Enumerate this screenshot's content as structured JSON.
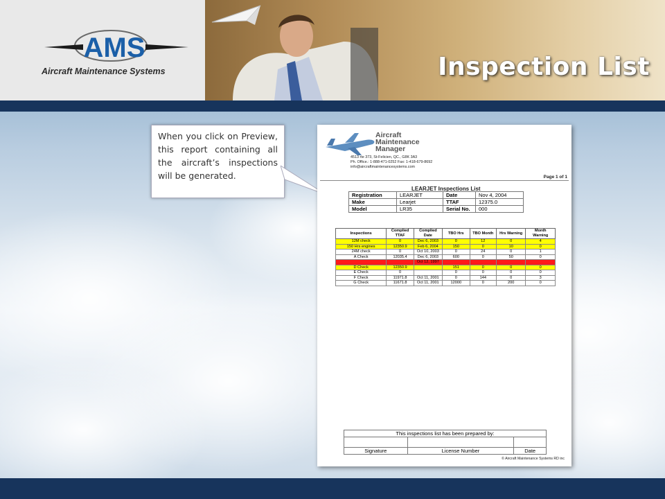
{
  "slide": {
    "title": "Inspection List",
    "logo_text": "AMS",
    "logo_subtitle": "Aircraft Maintenance Systems",
    "callout": "When you click on Preview, this report containing all the aircraft’s inspections will be generated.",
    "colors": {
      "bar": "#17345c",
      "title": "#ffffff",
      "logo_blue": "#1b5fa8",
      "row_yellow": "#ffff00",
      "row_red": "#ff1a1a"
    }
  },
  "report": {
    "brand_line1": "Aircraft",
    "brand_line2": "Maintenance",
    "brand_line3": "Manager",
    "address": "4513 rte 373, St-Felicien, QC., G8K 3A3",
    "phone": "Ph. Office.: 1-888-471-0252  Fax: 1-418-679-8692",
    "email": "info@aircraftmaintenancesystems.com",
    "page": "Page 1 of 1",
    "title": "LEARJET Inspections List",
    "info": {
      "registration_label": "Registration",
      "registration": "LEARJET",
      "date_label": "Date",
      "date": "Nov 4, 2004",
      "make_label": "Make",
      "make": "Learjet",
      "ttaf_label": "TTAF",
      "ttaf": "12375.0",
      "model_label": "Model",
      "model": "LR35",
      "serial_label": "Serial No.",
      "serial": "000"
    },
    "columns": [
      "Inspections",
      "Complied TTAF",
      "Complied Date",
      "TBO Hrs",
      "TBO Month",
      "Hrs Warning",
      "Month Warning"
    ],
    "rows": [
      {
        "cells": [
          "12M check",
          "0",
          "Dec 6, 2003",
          "0",
          "12",
          "0",
          "4"
        ],
        "highlight": "yellow"
      },
      {
        "cells": [
          "150 Hrs engines",
          "12350.9",
          "Feb 6, 2004",
          "150",
          "0",
          "10",
          "0"
        ],
        "highlight": "yellow"
      },
      {
        "cells": [
          "24M check",
          "0",
          "Oct 10, 2003",
          "0",
          "24",
          "0",
          "1"
        ],
        "highlight": "none"
      },
      {
        "cells": [
          "A Check",
          "12035.4",
          "Dec 6, 2003",
          "600",
          "0",
          "50",
          "0"
        ],
        "highlight": "none"
      },
      {
        "cells": [
          "",
          "",
          "Oct 12, 1997",
          "",
          "",
          "",
          ""
        ],
        "highlight": "red"
      },
      {
        "cells": [
          "D Check",
          "12350.9",
          "",
          "151",
          "0",
          "0",
          "0"
        ],
        "highlight": "yellow"
      },
      {
        "cells": [
          "E Check",
          "0",
          "",
          "0",
          "0",
          "0",
          "0"
        ],
        "highlight": "none"
      },
      {
        "cells": [
          "F Check",
          "11971.8",
          "Oct 11, 2001",
          "0",
          "144",
          "0",
          "3"
        ],
        "highlight": "none"
      },
      {
        "cells": [
          "G Check",
          "11671.8",
          "Oct 11, 2001",
          "12000",
          "0",
          "200",
          "0"
        ],
        "highlight": "none"
      }
    ],
    "prepared_by": "This inspections list has been prepared by:",
    "signature_label": "Signature",
    "license_label": "License Number",
    "date_col_label": "Date",
    "copyright": "© Aircraft Maintenance Systems RD inc"
  }
}
